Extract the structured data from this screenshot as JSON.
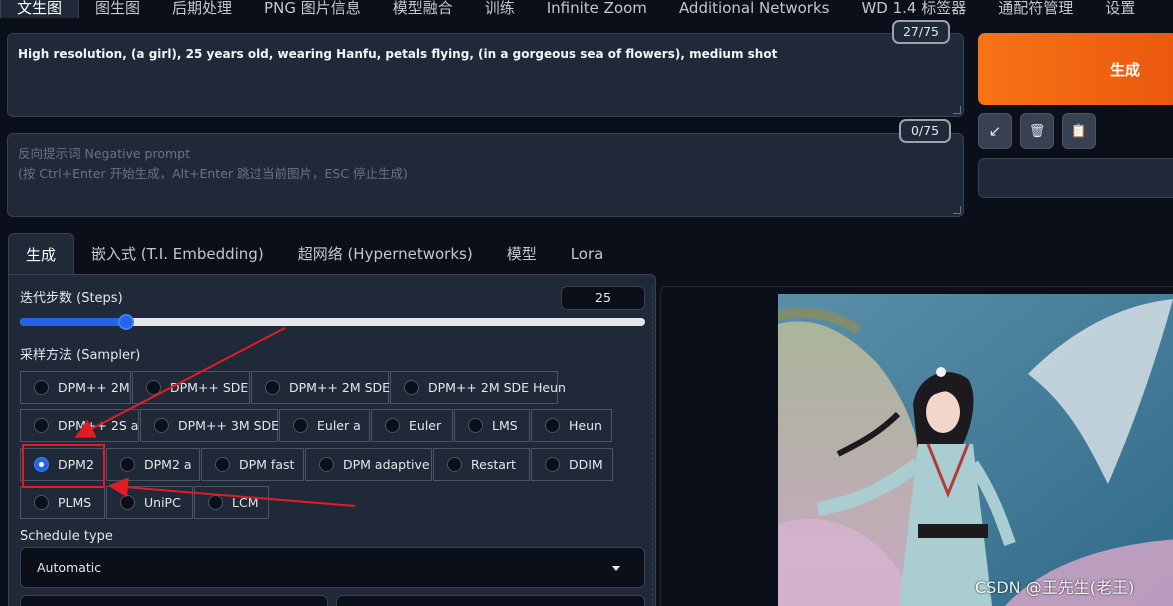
{
  "nav": {
    "tabs": [
      "文生图",
      "图生图",
      "后期处理",
      "PNG 图片信息",
      "模型融合",
      "训练",
      "Infinite Zoom",
      "Additional Networks",
      "WD 1.4 标签器",
      "通配符管理",
      "设置"
    ],
    "active": 0
  },
  "prompt": {
    "value": "High resolution, (a girl), 25 years old, wearing Hanfu, petals flying, (in a gorgeous sea of flowers), medium shot",
    "counter": "27/75"
  },
  "negative": {
    "placeholder_line1": "反向提示词 Negative prompt",
    "placeholder_line2": "(按 Ctrl+Enter 开始生成，Alt+Enter 跳过当前图片，ESC 停止生成)",
    "counter": "0/75"
  },
  "generate": {
    "label": "生成"
  },
  "tools": {
    "icons": [
      "pencil-arrow-icon",
      "trash-icon",
      "clipboard-icon"
    ],
    "glyphs": [
      "↙",
      "🗑",
      "📋"
    ]
  },
  "subtabs": {
    "items": [
      "生成",
      "嵌入式 (T.I. Embedding)",
      "超网络 (Hypernetworks)",
      "模型",
      "Lora"
    ],
    "active": 0
  },
  "steps": {
    "label": "迭代步数 (Steps)",
    "value": "25",
    "fraction": 0.17
  },
  "sampler": {
    "label": "采样方法 (Sampler)",
    "rows": [
      [
        "DPM++ 2M",
        "DPM++ SDE",
        "DPM++ 2M SDE",
        "DPM++ 2M SDE Heun"
      ],
      [
        "DPM++ 2S a",
        "DPM++ 3M SDE",
        "Euler a",
        "Euler",
        "LMS",
        "Heun"
      ],
      [
        "DPM2",
        "DPM2 a",
        "DPM fast",
        "DPM adaptive",
        "Restart",
        "DDIM"
      ],
      [
        "PLMS",
        "UniPC",
        "LCM"
      ]
    ],
    "selected": "DPM2"
  },
  "schedule": {
    "label": "Schedule type",
    "value": "Automatic"
  },
  "watermark": "CSDN @王先生(老王)",
  "colors": {
    "accent": "#2563eb",
    "generate": "#f97316",
    "annotation": "#e11d24"
  }
}
